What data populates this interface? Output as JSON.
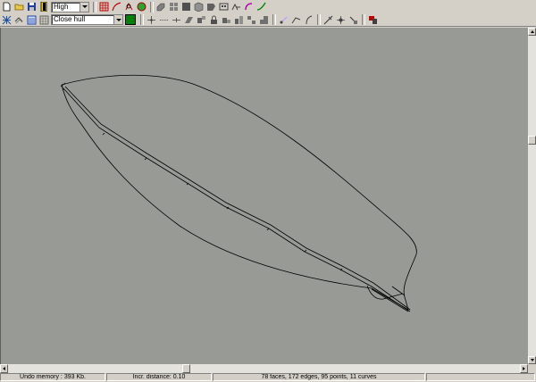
{
  "toolbar_top": {
    "quality_select": {
      "value": "High"
    },
    "icons": [
      "new-file-icon",
      "open-file-icon",
      "save-icon",
      "exit-icon",
      "grid-icon",
      "curve-icon",
      "mirror-icon",
      "shaded-view-icon",
      "perspective-icon",
      "views-icon",
      "layers-icon",
      "cube-icon",
      "hydrostatics-icon",
      "crosscurves-icon",
      "develop-icon",
      "arc-icon",
      "spline-icon"
    ]
  },
  "toolbar_bottom": {
    "action_select": {
      "value": "Close hull"
    },
    "icons": [
      "fit-all-icon",
      "flip-icon",
      "layer-properties-icon",
      "grid-lines-icon",
      "add-point-icon",
      "insert-edge-icon",
      "split-edge-icon",
      "new-face-icon",
      "collapse-point-icon",
      "lock-point-icon",
      "unlock-point-icon",
      "extrude-icon",
      "assemble-icon",
      "subdivide-icon",
      "remove-face-icon",
      "knuckle-icon",
      "check-model-icon",
      "delete-icon"
    ]
  },
  "colors": {
    "swatch": "#008000",
    "viewport": "#989a96",
    "model_line": "#000000"
  },
  "statusbar": {
    "undo_memory": "Undo memory : 393 Kb.",
    "incr_distance": "Incr. distance: 0.10",
    "model_stats": "78 faces, 172 edges, 95 points, 11 curves"
  }
}
